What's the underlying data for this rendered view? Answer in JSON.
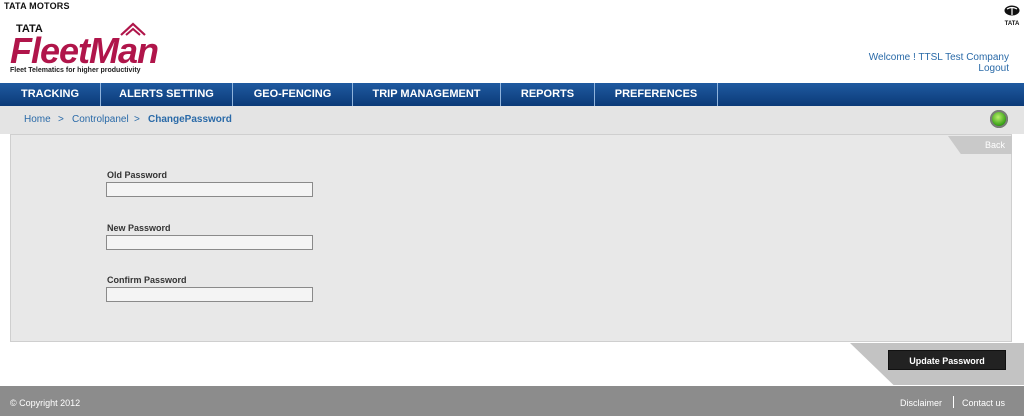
{
  "header": {
    "brand_top": "TATA MOTORS",
    "logo_tata": "TATA",
    "logo_name": "FleetMan",
    "tagline": "Fleet Telematics for higher productivity",
    "right_logo_label": "TATA",
    "welcome": "Welcome ! TTSL Test Company",
    "logout": "Logout"
  },
  "nav": {
    "items": [
      {
        "label": "TRACKING"
      },
      {
        "label": "ALERTS SETTING"
      },
      {
        "label": "GEO-FENCING"
      },
      {
        "label": "TRIP MANAGEMENT"
      },
      {
        "label": "REPORTS"
      },
      {
        "label": "PREFERENCES"
      }
    ]
  },
  "breadcrumb": {
    "home": "Home",
    "sep": ">",
    "controlpanel": "Controlpanel",
    "current": "ChangePassword"
  },
  "form": {
    "back": "Back",
    "old_password_label": "Old Password",
    "old_password_value": "",
    "new_password_label": "New Password",
    "new_password_value": "",
    "confirm_password_label": "Confirm Password",
    "confirm_password_value": "",
    "submit": "Update Password"
  },
  "footer": {
    "copyright": "© Copyright 2012",
    "disclaimer": "Disclaimer",
    "contact": "Contact us"
  },
  "colors": {
    "nav_bg": "#0b3a78",
    "logo": "#b0154a",
    "link": "#2a6aa8",
    "status": "#2e9a10"
  }
}
